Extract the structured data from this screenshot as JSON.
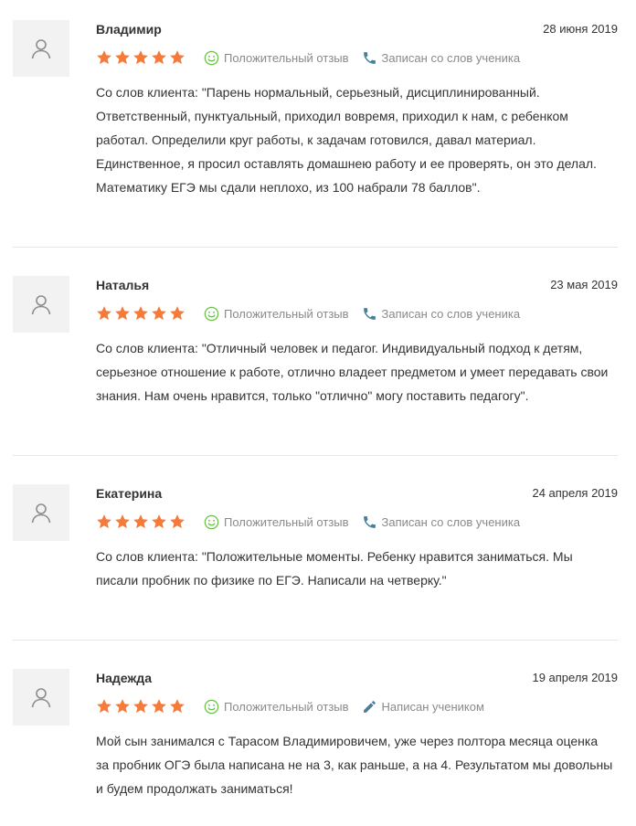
{
  "reviews": [
    {
      "name": "Владимир",
      "date": "28 июня 2019",
      "rating": 5,
      "sentiment": "Положительный отзыв",
      "source": "Записан со слов ученика",
      "source_icon": "phone-icon",
      "lines": [
        "Со слов клиента: \"Парень нормальный, серьезный, дисциплинированный.",
        "Ответственный, пунктуальный, приходил вовремя, приходил к нам, с ребенком",
        "работал. Определили круг работы, к задачам готовился, давал материал.",
        "Единственное, я просил оставлять домашнею работу и ее проверять, он это делал.",
        "Математику ЕГЭ мы сдали неплохо, из 100 набрали 78 баллов\"."
      ]
    },
    {
      "name": "Наталья",
      "date": "23 мая 2019",
      "rating": 5,
      "sentiment": "Положительный отзыв",
      "source": "Записан со слов ученика",
      "source_icon": "phone-icon",
      "lines": [
        "Со слов клиента: \"Отличный человек и педагог. Индивидуальный подход к детям,",
        "серьезное отношение к работе, отлично владеет предметом и умеет передавать свои",
        "знания. Нам очень нравится, только \"отлично\" могу поставить педагогу\"."
      ]
    },
    {
      "name": "Екатерина",
      "date": "24 апреля 2019",
      "rating": 5,
      "sentiment": "Положительный отзыв",
      "source": "Записан со слов ученика",
      "source_icon": "phone-icon",
      "lines": [
        "Со слов клиента: \"Положительные моменты. Ребенку нравится заниматься. Мы",
        "писали пробник по физике по ЕГЭ. Написали на четверку.\""
      ]
    },
    {
      "name": "Надежда",
      "date": "19 апреля 2019",
      "rating": 5,
      "sentiment": "Положительный отзыв",
      "source": "Написан учеником",
      "source_icon": "pencil-icon",
      "lines": [
        "Мой сын занимался с Тарасом Владимировичем, уже через полтора месяца оценка",
        "за пробник ОГЭ была написана не на 3, как раньше, а на 4. Результатом мы довольны",
        "и будем продолжать заниматься!"
      ]
    }
  ],
  "colors": {
    "star": "#f47b3a",
    "smile": "#6cc04a",
    "phone": "#4a7f9a",
    "meta_text": "#8a8a8a",
    "avatar_bg": "#f2f2f2",
    "divider": "#e6e6e6"
  }
}
